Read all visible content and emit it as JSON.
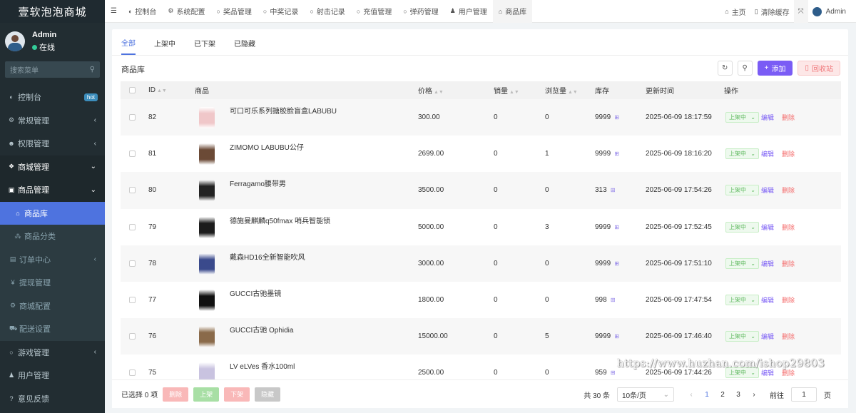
{
  "brand": "壹软泡泡商城",
  "user": {
    "name": "Admin",
    "status": "在线"
  },
  "search": {
    "placeholder": "搜索菜单"
  },
  "menu": [
    {
      "label": "控制台",
      "icon": "dashboard-icon",
      "badge": "hot"
    },
    {
      "label": "常规管理",
      "icon": "cogs-icon",
      "arrow": "‹"
    },
    {
      "label": "权限管理",
      "icon": "users-icon",
      "arrow": "‹"
    },
    {
      "label": "商城管理",
      "icon": "shop-icon",
      "arrow": "⌄"
    },
    {
      "label": "商品管理",
      "icon": "box-icon",
      "arrow": "⌄"
    },
    {
      "label": "商品库",
      "icon": "lock-icon"
    },
    {
      "label": "商品分类",
      "icon": "sitemap-icon"
    },
    {
      "label": "订单中心",
      "icon": "file-icon",
      "arrow": "‹"
    },
    {
      "label": "提现管理",
      "icon": "yen-icon"
    },
    {
      "label": "商城配置",
      "icon": "cogs-icon"
    },
    {
      "label": "配送设置",
      "icon": "car-icon"
    },
    {
      "label": "游戏管理",
      "icon": "circle-icon",
      "arrow": "‹"
    },
    {
      "label": "用户管理",
      "icon": "user-icon"
    },
    {
      "label": "意见反馈",
      "icon": "question-icon"
    }
  ],
  "topnav": {
    "items": [
      "控制台",
      "系统配置",
      "奖品管理",
      "中奖记录",
      "射击记录",
      "充值管理",
      "弹药管理",
      "用户管理",
      "商品库"
    ],
    "home": "主页",
    "clear": "清除缓存",
    "admin": "Admin"
  },
  "tabs": [
    "全部",
    "上架中",
    "已下架",
    "已隐藏"
  ],
  "library_title": "商品库",
  "buttons": {
    "add": "添加",
    "recycle": "回收站"
  },
  "columns": {
    "id": "ID",
    "product": "商品",
    "price": "价格",
    "sales": "销量",
    "views": "浏览量",
    "stock": "库存",
    "updated": "更新时间",
    "action": "操作"
  },
  "rows": [
    {
      "id": "82",
      "name": "可口可乐系列搪胶脸盲盒LABUBU",
      "price": "300.00",
      "sales": "0",
      "views": "0",
      "stock": "9999",
      "time": "2025-06-09 18:17:59",
      "img": "#f0c7c9"
    },
    {
      "id": "81",
      "name": "ZIMOMO LABUBU公仔",
      "price": "2699.00",
      "sales": "0",
      "views": "1",
      "stock": "9999",
      "time": "2025-06-09 18:16:20",
      "img": "#6b4a36"
    },
    {
      "id": "80",
      "name": "Ferragamo腰带男",
      "price": "3500.00",
      "sales": "0",
      "views": "0",
      "stock": "313",
      "time": "2025-06-09 17:54:26",
      "img": "#222222"
    },
    {
      "id": "79",
      "name": "德施曼麒麟q50fmax 哨兵智能锁",
      "price": "5000.00",
      "sales": "0",
      "views": "3",
      "stock": "9999",
      "time": "2025-06-09 17:52:45",
      "img": "#1c1c1c"
    },
    {
      "id": "78",
      "name": "戴森HD16全新智能吹风",
      "price": "3000.00",
      "sales": "0",
      "views": "0",
      "stock": "9999",
      "time": "2025-06-09 17:51:10",
      "img": "#3a4a8c"
    },
    {
      "id": "77",
      "name": "GUCCI古驰墨镜",
      "price": "1800.00",
      "sales": "0",
      "views": "0",
      "stock": "998",
      "time": "2025-06-09 17:47:54",
      "img": "#111111"
    },
    {
      "id": "76",
      "name": "GUCCI古驰 Ophidia",
      "price": "15000.00",
      "sales": "0",
      "views": "5",
      "stock": "9999",
      "time": "2025-06-09 17:46:40",
      "img": "#8a6a4a"
    },
    {
      "id": "75",
      "name": "LV eLVes 香水100ml",
      "price": "2500.00",
      "sales": "0",
      "views": "0",
      "stock": "959",
      "time": "2025-06-09 17:44:26",
      "img": "#c9c3e0"
    }
  ],
  "row_actions": {
    "status": "上架中",
    "edit": "编辑",
    "delete": "删除"
  },
  "footer": {
    "selected": "已选择 0 项",
    "delete": "删除",
    "on": "上架",
    "off": "下架",
    "hide": "隐藏",
    "total": "共 30 条",
    "per_page": "10条/页",
    "pages": [
      "1",
      "2",
      "3"
    ],
    "goto": "前往",
    "goto_value": "1",
    "page_suffix": "页"
  },
  "watermark": "https://www.huzhan.com/ishop29803"
}
